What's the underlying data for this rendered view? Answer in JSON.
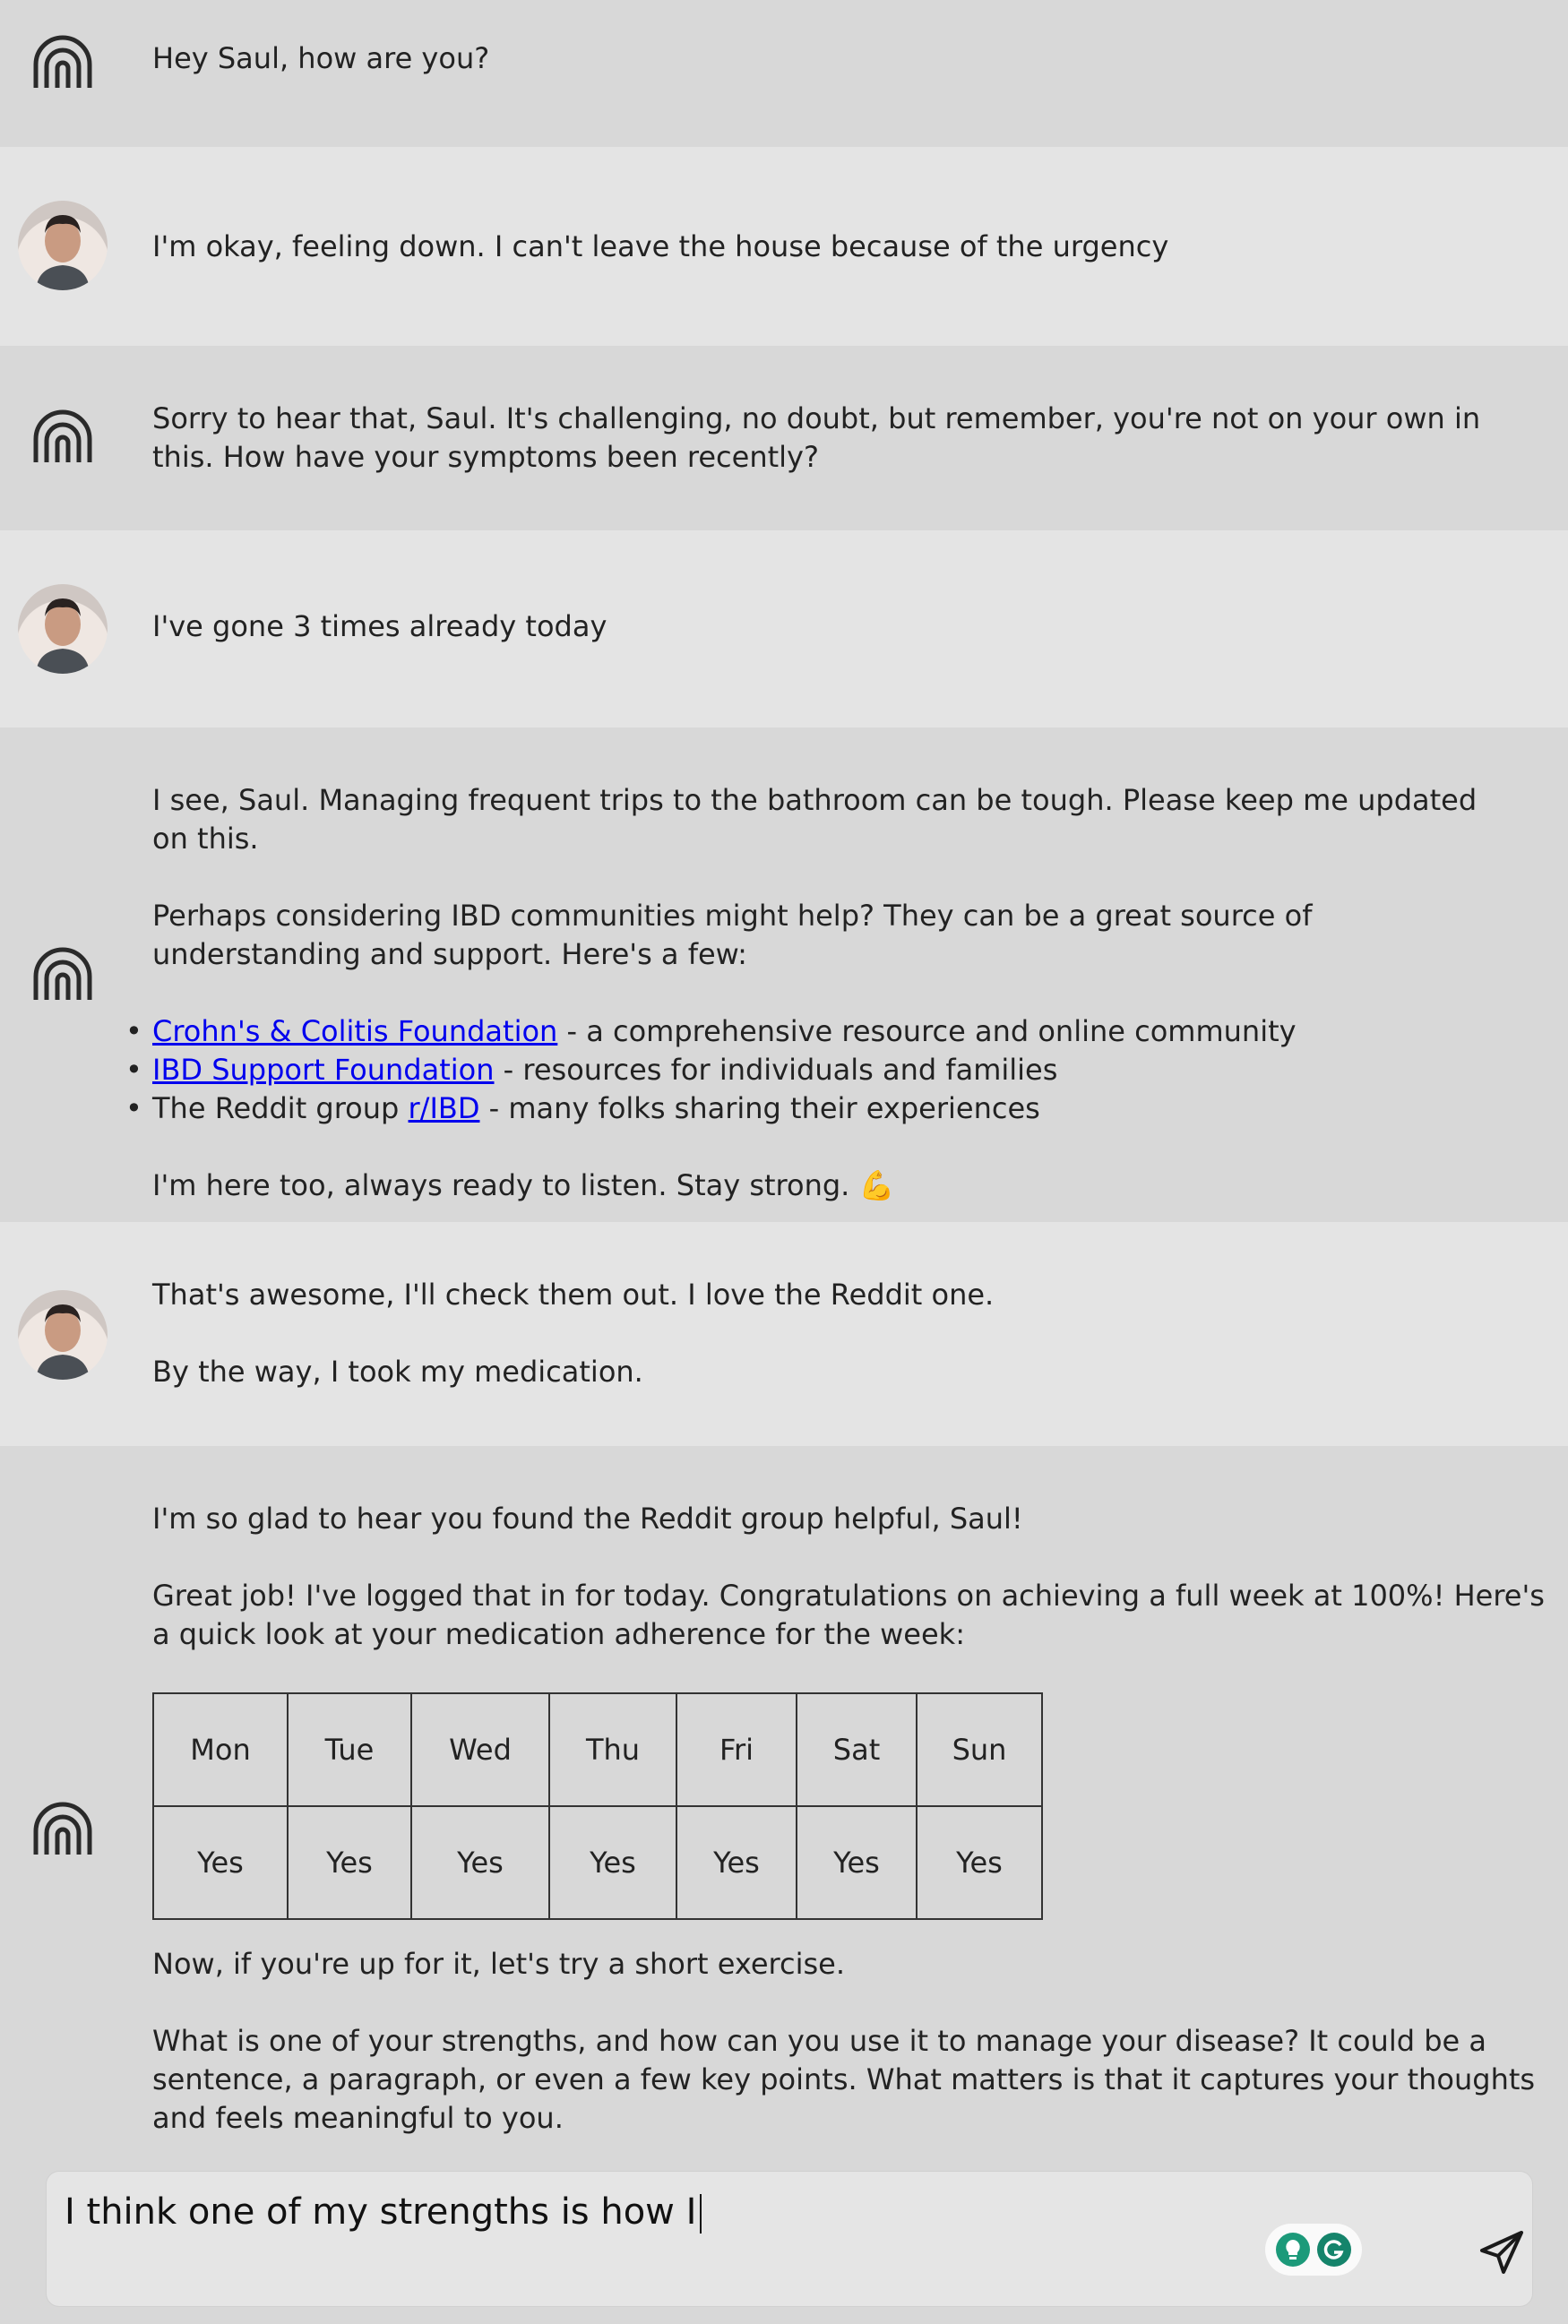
{
  "conversation": [
    {
      "role": "bot",
      "paragraphs": [
        "Hey Saul, how are you?"
      ]
    },
    {
      "role": "user",
      "paragraphs": [
        "I'm okay, feeling down. I can't leave the house because of the urgency"
      ]
    },
    {
      "role": "bot",
      "paragraphs": [
        "Sorry to hear that, Saul. It's challenging, no doubt, but remember, you're not on your own in this. How have your symptoms been recently?"
      ]
    },
    {
      "role": "user",
      "paragraphs": [
        "I've gone 3 times already today"
      ]
    },
    {
      "role": "bot",
      "p1": "I see, Saul. Managing frequent trips to the bathroom can be tough. Please keep me updated on this.",
      "p2": "Perhaps considering IBD communities might help? They can be a great source of understanding and support. Here's a few:",
      "links": [
        {
          "prefix": "",
          "link": "Crohn's & Colitis Foundation",
          "suffix": " - a comprehensive resource and online community"
        },
        {
          "prefix": "",
          "link": "IBD Support Foundation",
          "suffix": " - resources for individuals and families"
        },
        {
          "prefix": "The Reddit group ",
          "link": "r/IBD",
          "suffix": " - many folks sharing their experiences"
        }
      ],
      "p3": "I'm here too, always ready to listen. Stay strong. 💪"
    },
    {
      "role": "user",
      "paragraphs": [
        "That's awesome, I'll check them out. I love the Reddit one.",
        "By the way, I took my medication."
      ]
    },
    {
      "role": "bot",
      "p1": "I'm so glad to hear you found the Reddit group helpful, Saul!",
      "p2": "Great job! I've logged that in for today. Congratulations on achieving a full week at 100%! Here's a quick look at your medication adherence for the week:",
      "table": {
        "days": [
          "Mon",
          "Tue",
          "Wed",
          "Thu",
          "Fri",
          "Sat",
          "Sun"
        ],
        "values": [
          "Yes",
          "Yes",
          "Yes",
          "Yes",
          "Yes",
          "Yes",
          "Yes"
        ]
      },
      "p3": "Now, if you're up for it, let's try a short exercise.",
      "p4": "What is one of your strengths, and how can you use it to manage your disease? It could be a sentence, a paragraph, or even a few key points. What matters is that it captures your thoughts and feels meaningful to you."
    }
  ],
  "composer": {
    "text": "I think one of my strengths is how I"
  },
  "icons": {
    "bot": "arch-logo-icon",
    "send": "send-icon",
    "grammar": "grammarly-icon",
    "assist": "lightbulb-icon"
  },
  "colors": {
    "link": "#0000ee",
    "bot_bg": "#d8d8d8",
    "user_bg": "#e4e4e4",
    "grammarly": "#15846b"
  }
}
